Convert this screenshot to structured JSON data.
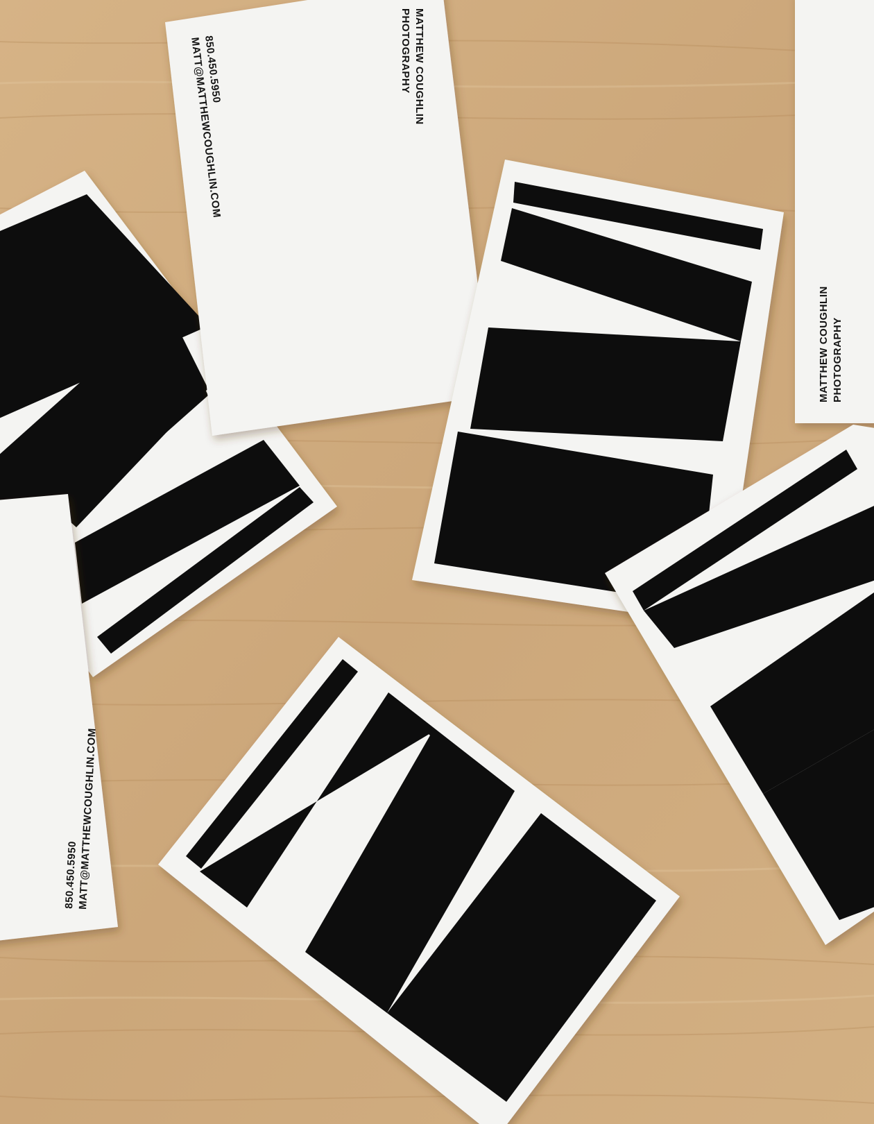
{
  "scene": {
    "description_tag": "business cards scattered on wooden table",
    "colors": {
      "wood": "#cfab7e",
      "wood_dark": "#b98f5e",
      "wood_light": "#dcbd93",
      "card": "#f4f4f2",
      "ink": "#0c0c0c"
    }
  },
  "card_top": {
    "name_line1": "MATTHEW COUGHLIN",
    "name_line2": "PHOTOGRAPHY",
    "phone": "850.450.5950",
    "email": "MATT@MATTHEWCOUGHLIN.COM"
  },
  "card_right": {
    "name_line1": "MATTHEW COUGHLIN",
    "name_line2": "PHOTOGRAPHY"
  },
  "card_left": {
    "phone": "850.450.5950",
    "email": "MATT@MATTHEWCOUGHLIN.COM"
  }
}
